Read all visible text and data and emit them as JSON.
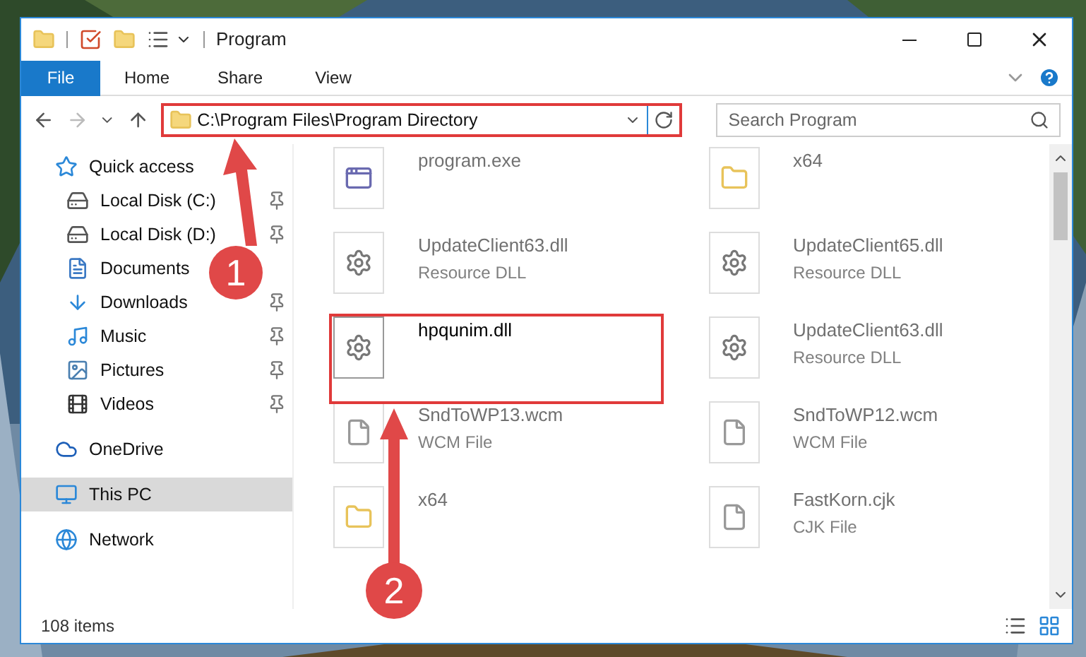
{
  "window": {
    "title": "Program"
  },
  "ribbon_tabs": [
    {
      "label": "File",
      "kind": "file"
    },
    {
      "label": "Home",
      "kind": "tab"
    },
    {
      "label": "Share",
      "kind": "tab"
    },
    {
      "label": "View",
      "kind": "tab"
    }
  ],
  "address_bar": {
    "path": "C:\\Program Files\\Program Directory"
  },
  "search": {
    "placeholder": "Search Program"
  },
  "sidebar": {
    "items": [
      {
        "label": "Quick access",
        "kind": "star",
        "selected": false,
        "children": [
          {
            "label": "Local Disk (C:)",
            "kind": "disk",
            "pinned": true
          },
          {
            "label": "Local Disk (D:)",
            "kind": "disk",
            "pinned": true
          },
          {
            "label": "Documents",
            "kind": "document",
            "pinned": false
          },
          {
            "label": "Downloads",
            "kind": "download",
            "pinned": true
          },
          {
            "label": "Music",
            "kind": "music",
            "pinned": true
          },
          {
            "label": "Pictures",
            "kind": "pictures",
            "pinned": true
          },
          {
            "label": "Videos",
            "kind": "video",
            "pinned": true
          }
        ]
      },
      {
        "label": "OneDrive",
        "kind": "cloud",
        "selected": false
      },
      {
        "label": "This PC",
        "kind": "pc",
        "selected": true
      },
      {
        "label": "Network",
        "kind": "network",
        "selected": false
      }
    ]
  },
  "files": [
    {
      "name": "program.exe",
      "kind": "app",
      "dimmed": true
    },
    {
      "name": "x64",
      "kind": "folder",
      "dimmed": true
    },
    {
      "name": "UpdateClient63.dll",
      "type": "Resource DLL",
      "kind": "dll",
      "dimmed": true
    },
    {
      "name": "UpdateClient65.dll",
      "type": "Resource DLL",
      "kind": "dll",
      "dimmed": true
    },
    {
      "name": "hpqunim.dll",
      "kind": "dll",
      "dimmed": false
    },
    {
      "name": "UpdateClient63.dll",
      "type": "Resource DLL",
      "kind": "dll",
      "dimmed": true
    },
    {
      "name": "SndToWP13.wcm",
      "type": "WCM File",
      "kind": "file",
      "dimmed": true
    },
    {
      "name": "SndToWP12.wcm",
      "type": "WCM File",
      "kind": "file",
      "dimmed": true
    },
    {
      "name": "x64",
      "kind": "folder",
      "dimmed": true
    },
    {
      "name": "FastKorn.cjk",
      "type": "CJK File",
      "kind": "file",
      "dimmed": true
    }
  ],
  "status_bar": {
    "text": "108 items"
  },
  "annotations": [
    {
      "label": "1"
    },
    {
      "label": "2"
    }
  ]
}
